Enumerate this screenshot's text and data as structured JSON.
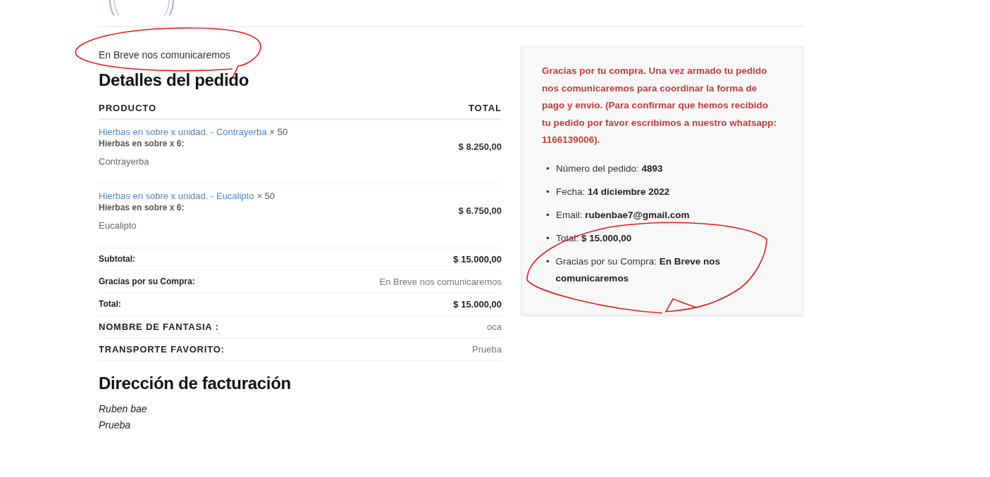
{
  "notice": "En Breve nos comunicaremos",
  "order_details": {
    "title": "Detalles del pedido",
    "columns": [
      "PRODUCTO",
      "TOTAL"
    ],
    "items": [
      {
        "name": "Hierbas en sobre x unidad. - Contrayerba",
        "quantity": "× 50",
        "meta_label": "Hierbas en sobre x 6:",
        "meta_value": "Contrayerba",
        "total": "$ 8.250,00"
      },
      {
        "name": "Hierbas en sobre x unidad. - Eucalipto",
        "quantity": "× 50",
        "meta_label": "Hierbas en sobre x 6:",
        "meta_value": "Eucalipto",
        "total": "$ 6.750,00"
      }
    ],
    "totals": [
      {
        "label": "Subtotal:",
        "value": "$ 15.000,00",
        "kind": "amount"
      },
      {
        "label": "Gracias por su Compra:",
        "value": "En Breve nos comunicaremos",
        "kind": "note"
      },
      {
        "label": "Total:",
        "value": "$ 15.000,00",
        "kind": "amount"
      }
    ]
  },
  "extra_fields": [
    {
      "label": "NOMBRE DE FANTASIA :",
      "value": "oca"
    },
    {
      "label": "TRANSPORTE FAVORITO:",
      "value": "Prueba"
    }
  ],
  "billing": {
    "title": "Dirección de facturación",
    "lines": [
      "Ruben bae",
      "Prueba"
    ]
  },
  "summary": {
    "message": "Gracias por tu compra. Una vez armado tu pedido nos comunicaremos para coordinar la forma de pago y envío. (Para confirmar que hemos recibido tu pedido por favor escribimos a nuestro whatsapp: 1166139006).",
    "items": [
      {
        "marker": "•",
        "label": "Número del pedido:",
        "value": "4893"
      },
      {
        "marker": "•",
        "label": "Fecha:",
        "value": "14 diciembre 2022"
      },
      {
        "marker": "•",
        "label": "Email:",
        "value": "rubenbae7@gmail.com"
      },
      {
        "marker": "•",
        "label": "Total:",
        "value": "$ 15.000,00"
      },
      {
        "marker": "•",
        "label": "Gracias por su Compra:",
        "value": "En Breve nos comunicaremos"
      }
    ]
  }
}
